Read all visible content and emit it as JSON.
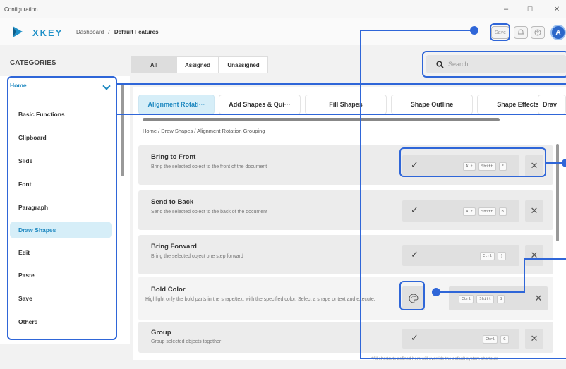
{
  "window": {
    "title": "Configuration",
    "minimize": "–",
    "maximize": "☐",
    "close": "✕"
  },
  "header": {
    "brand": "XKEY",
    "breadcrumb_root": "Dashboard",
    "breadcrumb_sep": "/",
    "breadcrumb_current": "Default Features",
    "save_label": "Save",
    "avatar_letter": "A"
  },
  "sidebar": {
    "title": "CATEGORIES",
    "group": "Home",
    "items": [
      "Basic Functions",
      "Clipboard",
      "Slide",
      "Font",
      "Paragraph",
      "Draw Shapes",
      "Edit",
      "Paste",
      "Save",
      "Others"
    ],
    "active_item": "Draw Shapes"
  },
  "filters": {
    "all": "All",
    "assigned": "Assigned",
    "unassigned": "Unassigned"
  },
  "search": {
    "placeholder": "Search"
  },
  "tabs": [
    "Alignment Rotati···",
    "Add Shapes & Qui···",
    "Fill Shapes",
    "Shape Outline",
    "Shape Effects",
    "Drav"
  ],
  "path": "Home / Draw Shapes / Alignment Rotation Grouping",
  "rows": [
    {
      "title": "Bring to Front",
      "desc": "Bring the selected object to the front of the document",
      "keys": [
        "Alt",
        "Shift",
        "F"
      ]
    },
    {
      "title": "Send to Back",
      "desc": "Send the selected object to the back of the document",
      "keys": [
        "Alt",
        "Shift",
        "B"
      ]
    },
    {
      "title": "Bring Forward",
      "desc": "Bring the selected object one step forward",
      "keys": [
        "Ctrl",
        "]"
      ]
    },
    {
      "title": "Bold Color",
      "desc": "Highlight only the bold parts in the shape/text with the specified color. Select a shape or text and execute.",
      "keys": [
        "Ctrl",
        "Shift",
        "B"
      ]
    },
    {
      "title": "Group",
      "desc": "Group selected objects together",
      "keys": [
        "Ctrl",
        "G"
      ]
    }
  ],
  "glyphs": {
    "check": "✓",
    "remove": "✕"
  },
  "footnote": "*All shortcuts defined here will override the default system shortcuts",
  "colors": {
    "accent": "#1e88c0",
    "highlight": "#2f66d8",
    "active_bg": "#d6eef8"
  },
  "icons": [
    "logo-icon",
    "bell-icon",
    "help-icon",
    "search-icon",
    "chevron-down-icon",
    "palette-icon"
  ]
}
